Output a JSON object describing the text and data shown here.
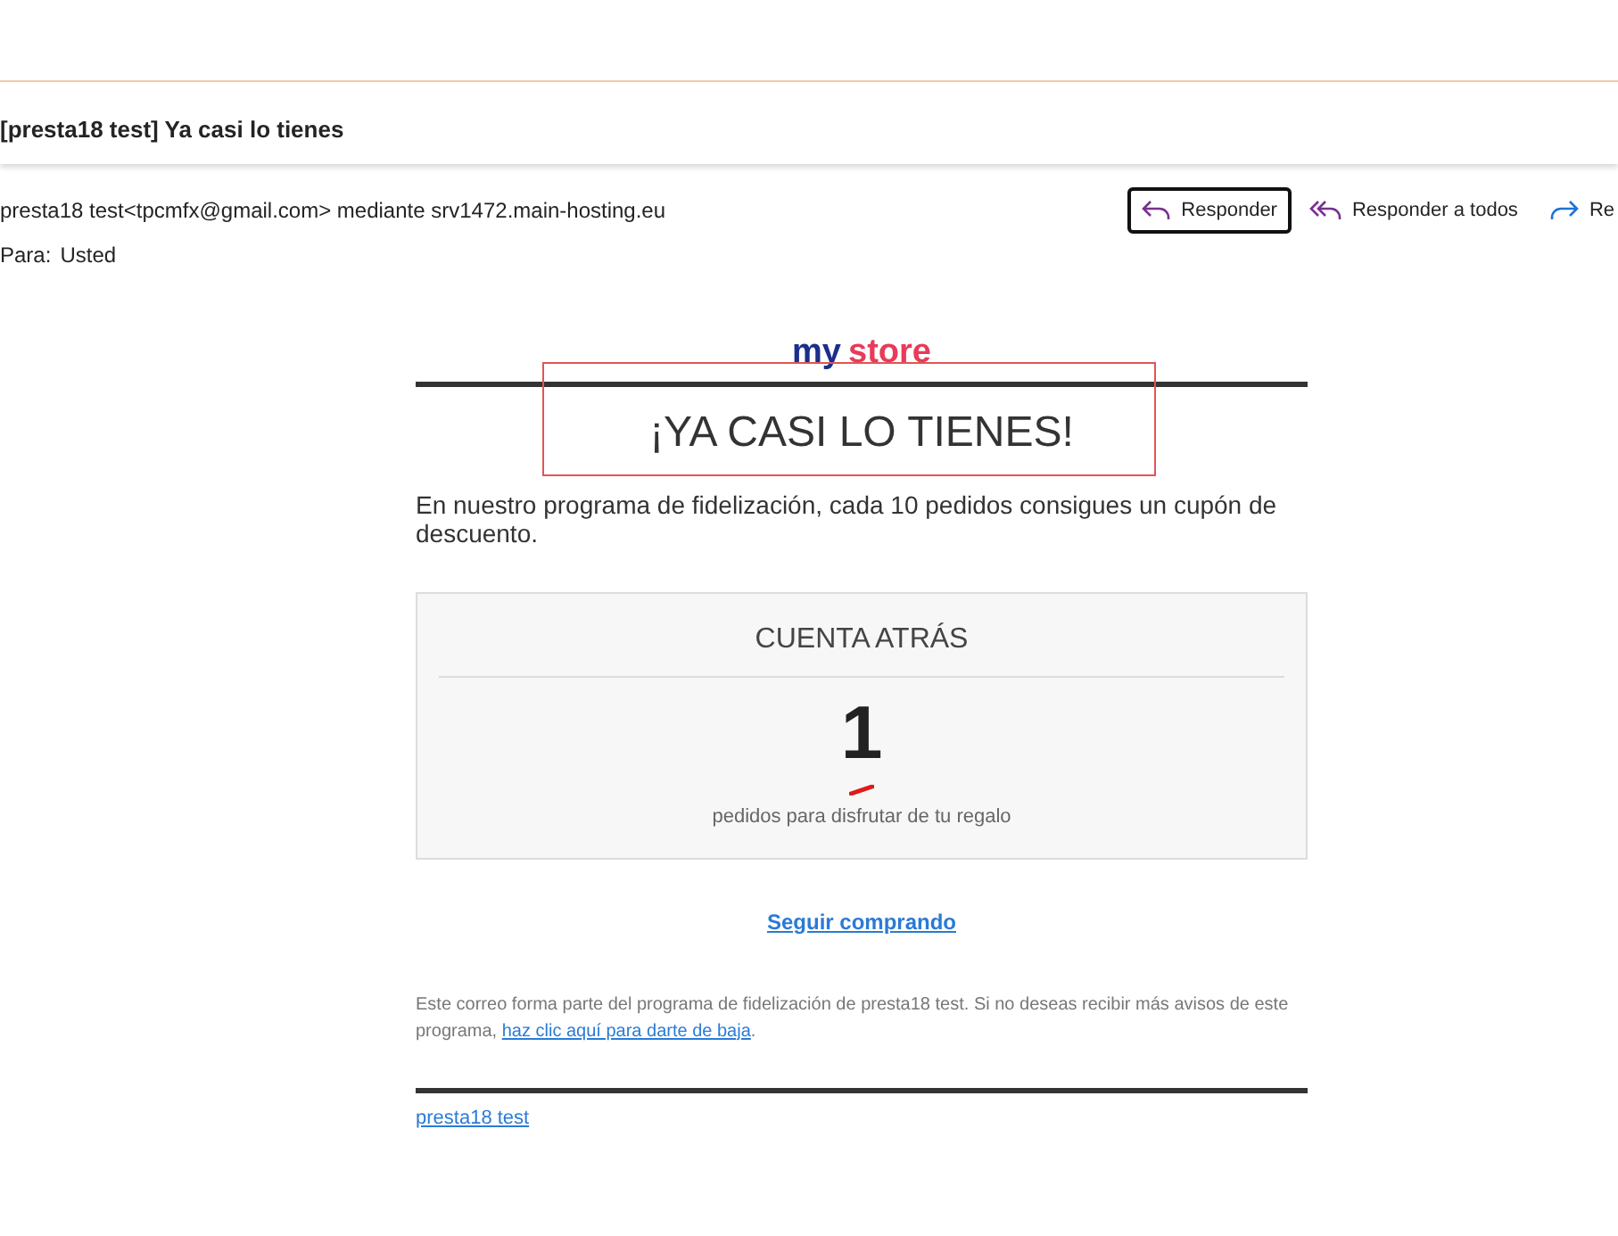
{
  "subject": "[presta18 test] Ya casi lo tienes",
  "sender": "presta18 test<tpcmfx@gmail.com> mediante srv1472.main-hosting.eu",
  "actions": [
    {
      "label": "Responder",
      "kind": "reply",
      "selected": true
    },
    {
      "label": "Responder a todos",
      "kind": "reply-all",
      "selected": false
    },
    {
      "label": "Re",
      "kind": "forward",
      "selected": false
    }
  ],
  "to": {
    "label": "Para:",
    "value": "Usted"
  },
  "email": {
    "logo": [
      "my",
      "store"
    ],
    "heading": "¡YA CASI LO TIENES!",
    "intro": "En nuestro programa de fidelización, cada 10 pedidos consigues un cupón de descuento.",
    "countdown": {
      "title": "CUENTA ATRÁS",
      "number": "1",
      "caption": "pedidos para disfrutar de tu regalo"
    },
    "cta": "Seguir comprando",
    "footer_text": "Este correo forma parte del programa de fidelización de presta18 test. Si no deseas recibir más avisos de este programa,",
    "footer_link": "haz clic aquí para darte de baja",
    "footer_end": ".",
    "signature": "presta18 test"
  }
}
